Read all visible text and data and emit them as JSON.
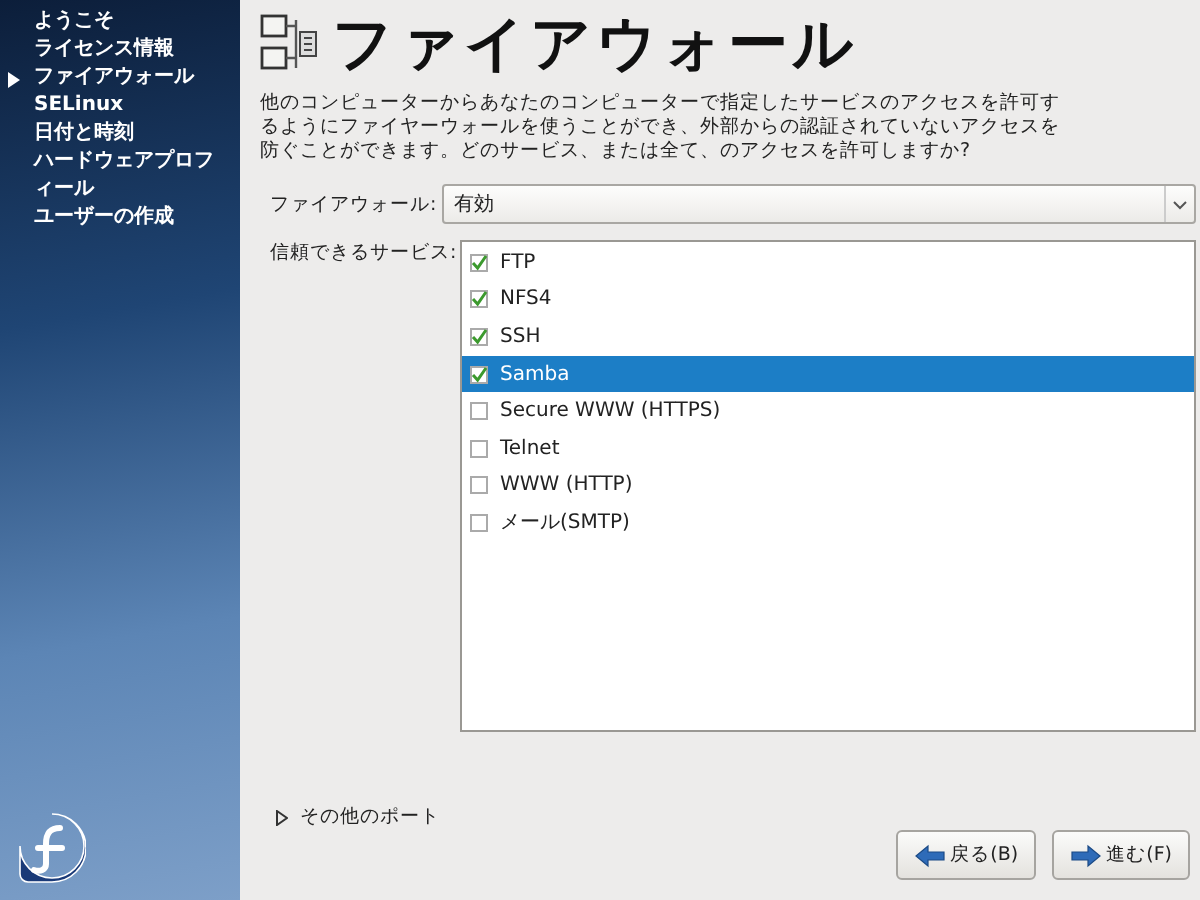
{
  "sidebar": {
    "items": [
      {
        "label": "ようこそ",
        "selected": false
      },
      {
        "label": "ライセンス情報",
        "selected": false
      },
      {
        "label": "ファイアウォール",
        "selected": true
      },
      {
        "label": "SELinux",
        "selected": false
      },
      {
        "label": "日付と時刻",
        "selected": false
      },
      {
        "label": "ハードウェアプロフィール",
        "selected": false
      },
      {
        "label": "ユーザーの作成",
        "selected": false
      }
    ]
  },
  "page": {
    "title": "ファイアウォール",
    "description": "他のコンピューターからあなたのコンピューターで指定したサービスのアクセスを許可するようにファイヤーウォールを使うことができ、外部からの認証されていないアクセスを防ぐことができます。どのサービス、または全て、のアクセスを許可しますか?"
  },
  "firewall": {
    "label": "ファイアウォール:",
    "value": "有効"
  },
  "services": {
    "label": "信頼できるサービス:",
    "items": [
      {
        "label": "FTP",
        "checked": true,
        "selected": false
      },
      {
        "label": "NFS4",
        "checked": true,
        "selected": false
      },
      {
        "label": "SSH",
        "checked": true,
        "selected": false
      },
      {
        "label": "Samba",
        "checked": true,
        "selected": true
      },
      {
        "label": "Secure WWW (HTTPS)",
        "checked": false,
        "selected": false
      },
      {
        "label": "Telnet",
        "checked": false,
        "selected": false
      },
      {
        "label": "WWW (HTTP)",
        "checked": false,
        "selected": false
      },
      {
        "label": "メール(SMTP)",
        "checked": false,
        "selected": false
      }
    ]
  },
  "other_ports": {
    "label": "その他のポート",
    "expanded": false
  },
  "buttons": [
    {
      "label": "戻る(B)",
      "kind": "back"
    },
    {
      "label": "進む(F)",
      "kind": "forward"
    }
  ]
}
